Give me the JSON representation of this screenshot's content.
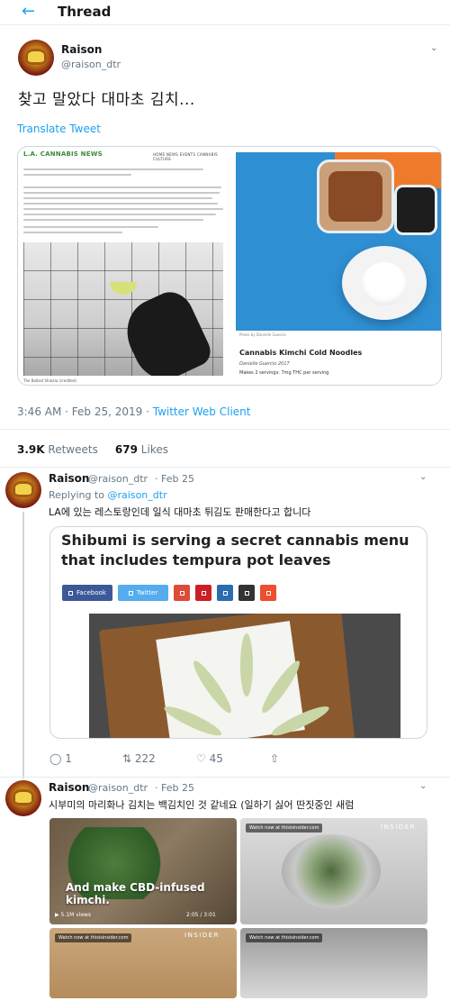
{
  "header": {
    "title": "Thread"
  },
  "main_tweet": {
    "name": "Raison",
    "handle": "@raison_dtr",
    "text": "찾고 말았다 대마초 김치...",
    "translate_label": "Translate Tweet",
    "article_left": {
      "logo": "L.A. CANNABIS NEWS",
      "nav": "HOME  NEWS  EVENTS  CANNABIS  CULTURE",
      "caption": "The Ballast Shalala (credited)"
    },
    "article_right": {
      "photo_credit": "Photo by Danielle Guercio",
      "title": "Cannabis Kimchi Cold Noodles",
      "author": "Danielle Guercio 2017",
      "servings": "Makes 2 servings: 7mg THC per serving"
    },
    "timestamp": "3:46 AM · Feb 25, 2019 · ",
    "source": "Twitter Web Client",
    "retweets_count": "3.9K",
    "retweets_label": "Retweets",
    "likes_count": "679",
    "likes_label": "Likes"
  },
  "reply1": {
    "name": "Raison",
    "handle": "@raison_dtr",
    "date": "· Feb 25",
    "replying_prefix": "Replying to ",
    "replying_handle": "@raison_dtr",
    "text": "LA에 있는 레스토랑인데 일식 대마초 튀김도 판매한다고 합니다",
    "card_headline": "Shibumi is serving a secret cannabis menu that includes tempura pot leaves",
    "share_buttons": [
      {
        "label": "Facebook",
        "color": "#3b5998"
      },
      {
        "label": "Twitter",
        "color": "#55acee"
      },
      {
        "label": "",
        "color": "#dd4b39"
      },
      {
        "label": "",
        "color": "#cb2027"
      },
      {
        "label": "",
        "color": "#2b6cb0"
      },
      {
        "label": "",
        "color": "#333333"
      },
      {
        "label": "",
        "color": "#ee4f2f"
      }
    ],
    "replies": "1",
    "retweets": "222",
    "likes": "45"
  },
  "reply2": {
    "name": "Raison",
    "handle": "@raison_dtr",
    "date": "· Feb 25",
    "text": "시부미의 마리화나 김치는 백김치인 것 같네요 (일하기 싫어 딴짓중인 새럼",
    "video_caption_line1": "And make CBD-infused",
    "video_caption_line2": "kimchi.",
    "video_views": "▶  5.1M views",
    "video_time": "2:05 / 3:01",
    "insider_label": "INSIDER",
    "watch_label": "Watch now at thisisinsider.com"
  },
  "colors": {
    "accent": "#1da1f2",
    "muted": "#657786"
  }
}
